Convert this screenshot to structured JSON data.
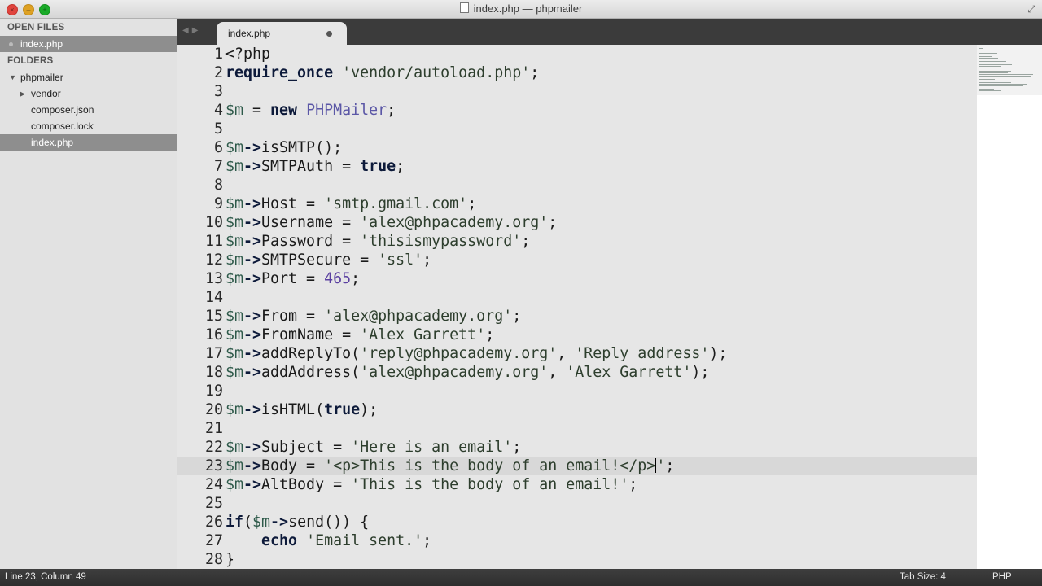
{
  "window": {
    "title": "index.php — phpmailer"
  },
  "sidebar": {
    "open_files_header": "OPEN FILES",
    "open_files": [
      "index.php"
    ],
    "folders_header": "FOLDERS",
    "tree": [
      {
        "label": "phpmailer",
        "type": "folder",
        "expanded": true,
        "depth": 0
      },
      {
        "label": "vendor",
        "type": "folder",
        "expanded": false,
        "depth": 1
      },
      {
        "label": "composer.json",
        "type": "file",
        "depth": 1
      },
      {
        "label": "composer.lock",
        "type": "file",
        "depth": 1
      },
      {
        "label": "index.php",
        "type": "file",
        "depth": 1,
        "selected": true
      }
    ]
  },
  "tabs": [
    {
      "label": "index.php",
      "modified": true,
      "active": true
    }
  ],
  "editor": {
    "current_line": 23,
    "lines": [
      "<?php",
      "require_once 'vendor/autoload.php';",
      "",
      "$m = new PHPMailer;",
      "",
      "$m->isSMTP();",
      "$m->SMTPAuth = true;",
      "",
      "$m->Host = 'smtp.gmail.com';",
      "$m->Username = 'alex@phpacademy.org';",
      "$m->Password = 'thisismypassword';",
      "$m->SMTPSecure = 'ssl';",
      "$m->Port = 465;",
      "",
      "$m->From = 'alex@phpacademy.org';",
      "$m->FromName = 'Alex Garrett';",
      "$m->addReplyTo('reply@phpacademy.org', 'Reply address');",
      "$m->addAddress('alex@phpacademy.org', 'Alex Garrett');",
      "",
      "$m->isHTML(true);",
      "",
      "$m->Subject = 'Here is an email';",
      "$m->Body = '<p>This is the body of an email!</p>';",
      "$m->AltBody = 'This is the body of an email!';",
      "",
      "if($m->send()) {",
      "    echo 'Email sent.';",
      "}"
    ]
  },
  "status": {
    "position": "Line 23, Column 49",
    "tab_size": "Tab Size: 4",
    "syntax": "PHP"
  },
  "colors": {
    "sidebar_bg": "#e2e2e2",
    "editor_bg": "#e6e6e6",
    "tabbar_bg": "#3b3b3b",
    "statusbar_bg": "#333333",
    "keyword": "#0d1a3a",
    "class_name": "#5b57a6"
  }
}
